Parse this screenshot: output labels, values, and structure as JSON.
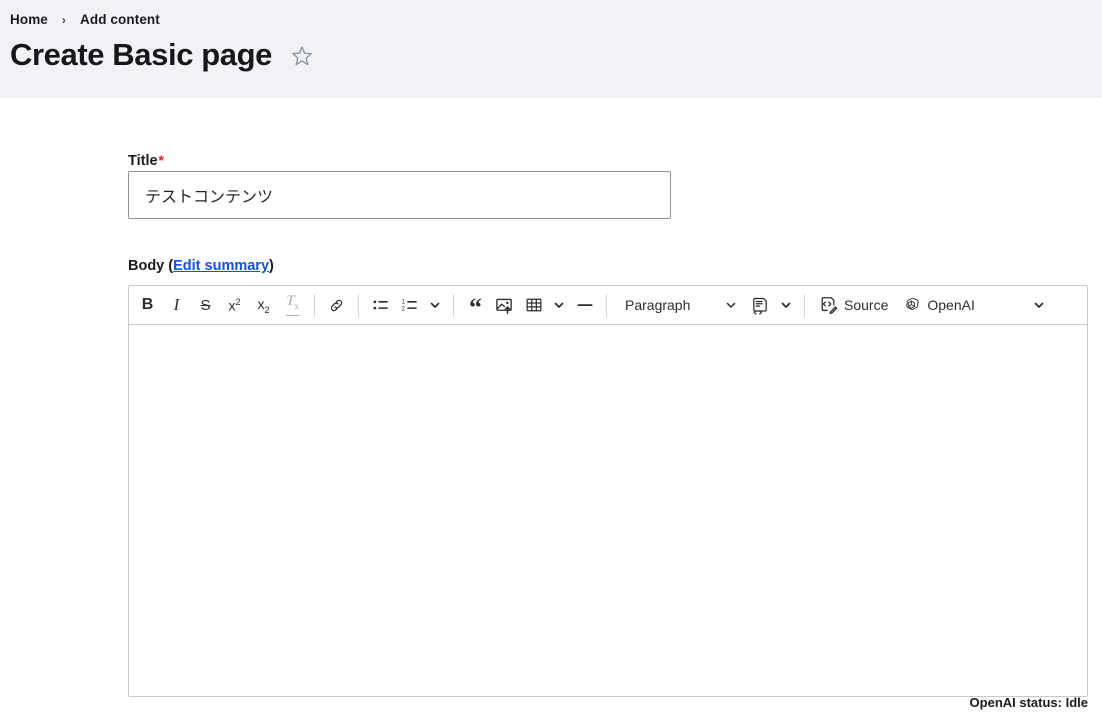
{
  "header": {
    "breadcrumb": [
      {
        "label": "Home",
        "name": "breadcrumb-home"
      },
      {
        "label": "Add content",
        "name": "breadcrumb-add-content"
      }
    ],
    "breadcrumb_separator": "›",
    "title": "Create Basic page",
    "star_icon": "star-outline-icon",
    "background_color": "#f1f2f7"
  },
  "form": {
    "title_field": {
      "label": "Title",
      "required_mark": "*",
      "value": "テストコンテンツ",
      "placeholder": ""
    },
    "body_field": {
      "label_prefix": "Body (",
      "edit_summary_link": "Edit summary",
      "label_suffix": ")",
      "link_color": "#0e55d7",
      "content": ""
    }
  },
  "toolbar": {
    "groups": [
      {
        "items": [
          {
            "name": "bold-button",
            "label": "B",
            "kind": "bold",
            "disabled": false
          },
          {
            "name": "italic-button",
            "label": "I",
            "kind": "italic",
            "disabled": false
          },
          {
            "name": "strikethrough-button",
            "label": "S",
            "kind": "strike",
            "disabled": false
          },
          {
            "name": "superscript-button",
            "label": "x2",
            "kind": "sup",
            "disabled": false
          },
          {
            "name": "subscript-button",
            "label": "x2",
            "kind": "sub",
            "disabled": false
          },
          {
            "name": "remove-format-button",
            "label": "Tx",
            "kind": "removeformat",
            "disabled": true
          }
        ]
      },
      {
        "items": [
          {
            "name": "link-button",
            "label": "Link",
            "kind": "link",
            "disabled": false
          }
        ]
      },
      {
        "items": [
          {
            "name": "bulleted-list-button",
            "label": "Bulleted List",
            "kind": "ul",
            "disabled": false
          },
          {
            "name": "numbered-list-button",
            "label": "Numbered List",
            "kind": "ol",
            "disabled": false
          },
          {
            "name": "list-options-chevron",
            "label": "",
            "kind": "chevron",
            "disabled": false
          }
        ]
      },
      {
        "items": [
          {
            "name": "block-quote-button",
            "label": "Block quote",
            "kind": "quote",
            "disabled": false
          },
          {
            "name": "insert-image-button",
            "label": "Insert image",
            "kind": "image",
            "disabled": false
          },
          {
            "name": "insert-table-button",
            "label": "Insert table",
            "kind": "table",
            "disabled": false
          },
          {
            "name": "table-options-chevron",
            "label": "",
            "kind": "chevron",
            "disabled": false
          },
          {
            "name": "horizontal-line-button",
            "label": "Horizontal line",
            "kind": "hr",
            "disabled": false
          }
        ]
      }
    ],
    "paragraph_dropdown": {
      "name": "paragraph-style-dropdown",
      "value": "Paragraph",
      "chevron": "chevron-down-icon"
    },
    "template_button": {
      "name": "template-button",
      "label": "Templates",
      "chevron": "chevron-down-icon"
    },
    "source_button": {
      "name": "source-editing-button",
      "label": "Source",
      "icon": "source-code-icon"
    },
    "openai_button": {
      "name": "openai-button",
      "label": "OpenAI",
      "icon": "openai-logo-icon",
      "chevron": "chevron-down-icon"
    }
  },
  "status": {
    "text": "OpenAI status: Idle"
  }
}
